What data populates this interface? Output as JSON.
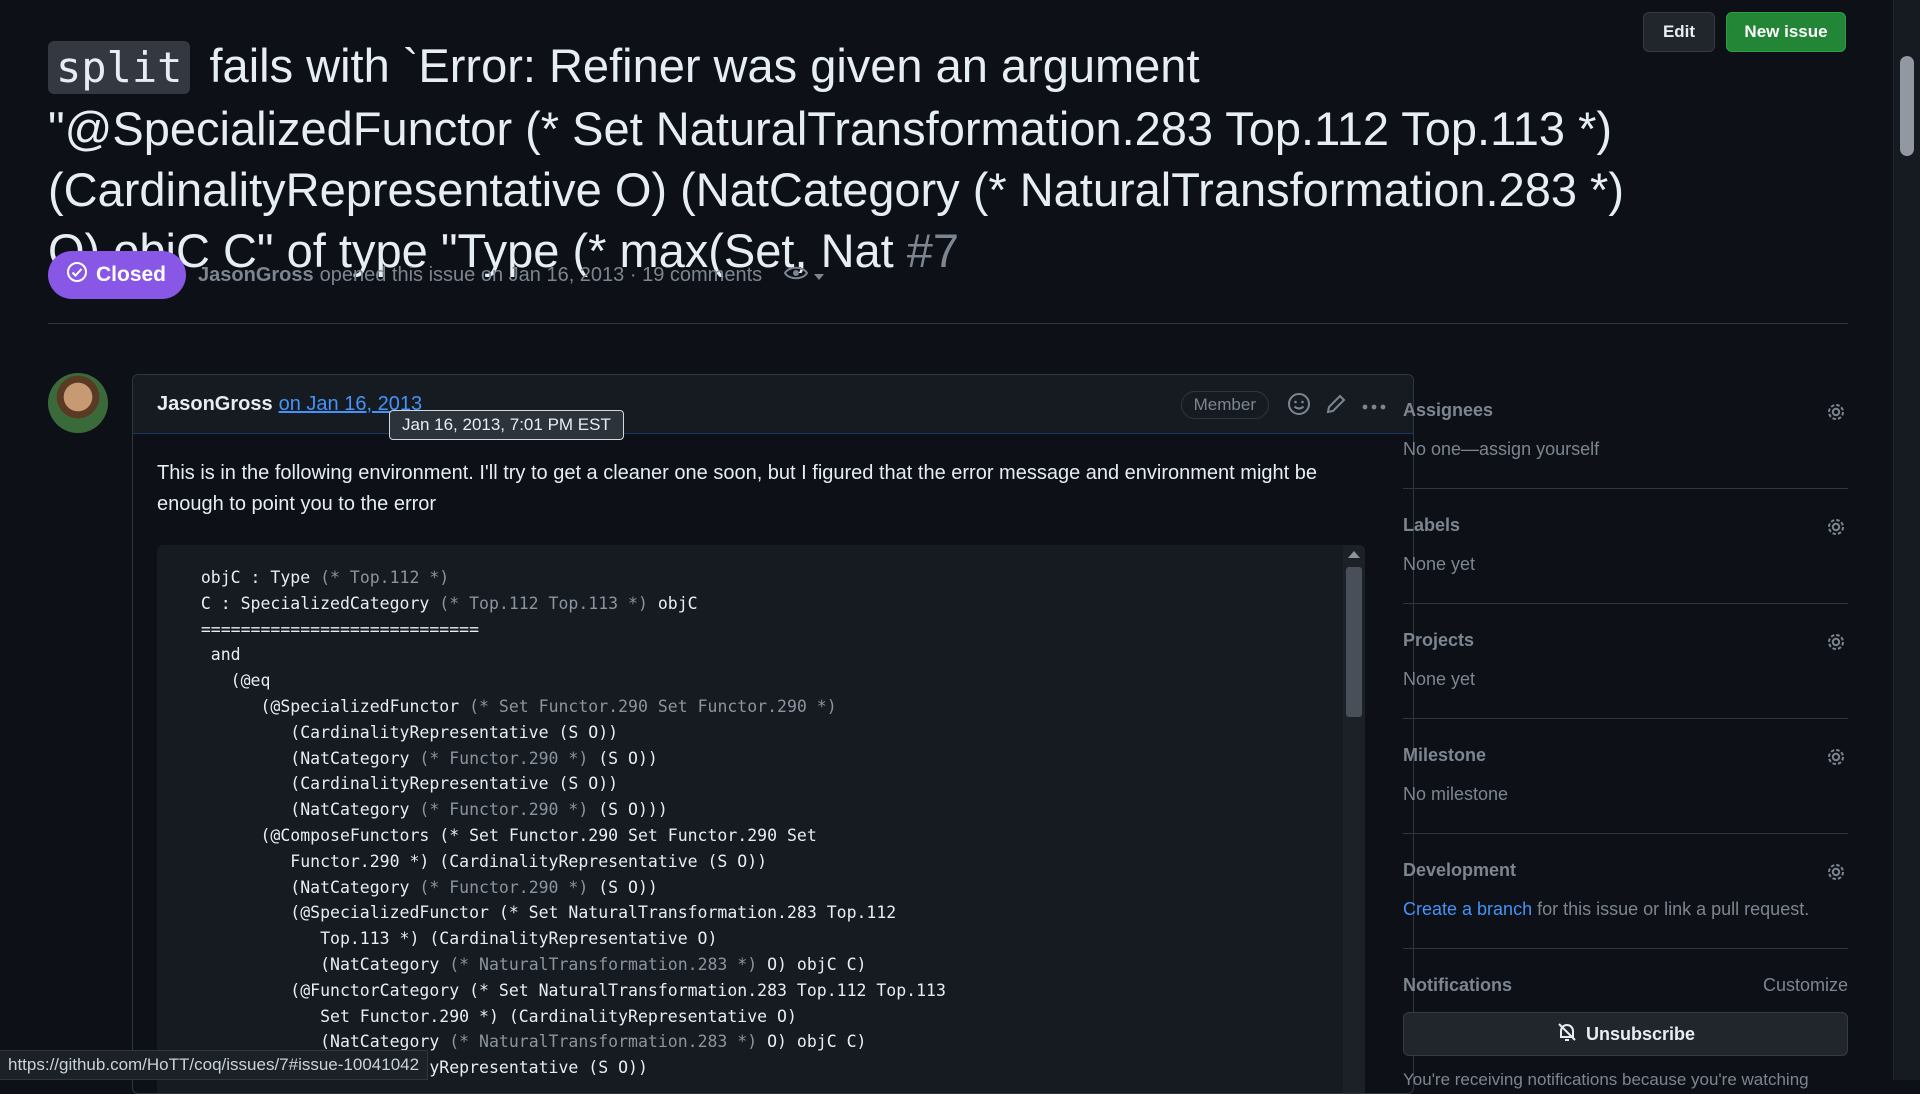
{
  "issue": {
    "title_code": "split",
    "title_text": " fails with `Error: Refiner was given an argument \"@SpecializedFunctor (* Set NaturalTransformation.283 Top.112 Top.113 *) (CardinalityRepresentative O) (NatCategory (* NaturalTransformation.283 *) O) objC C\" of type \"Type (* max(Set, Nat",
    "number": " #7",
    "status": "Closed",
    "author": "JasonGross",
    "opened_text": "opened this issue on Jan 16, 2013 · 19 comments"
  },
  "toolbar": {
    "edit_label": "Edit",
    "new_issue_label": "New issue"
  },
  "comment": {
    "author": "JasonGross",
    "date_link": "on Jan 16, 2013",
    "tooltip": "Jan 16, 2013, 7:01 PM EST",
    "badge": "Member",
    "body": "This is in the following environment. I'll try to get a cleaner one soon, but I figured that the error message and environment might be enough to point you to the error",
    "code_lines": [
      "  objC : Type (* Top.112 *)",
      "  C : SpecializedCategory (* Top.112 Top.113 *) objC",
      "  ============================",
      "   and",
      "     (@eq",
      "        (@SpecializedFunctor (* Set Functor.290 Set Functor.290 *)",
      "           (CardinalityRepresentative (S O))",
      "           (NatCategory (* Functor.290 *) (S O))",
      "           (CardinalityRepresentative (S O))",
      "           (NatCategory (* Functor.290 *) (S O)))",
      "        (@ComposeFunctors (* Set Functor.290 Set Functor.290 Set",
      "           Functor.290 *) (CardinalityRepresentative (S O))",
      "           (NatCategory (* Functor.290 *) (S O))",
      "           (@SpecializedFunctor (* Set NaturalTransformation.283 Top.112",
      "              Top.113 *) (CardinalityRepresentative O)",
      "              (NatCategory (* NaturalTransformation.283 *) O) objC C)",
      "           (@FunctorCategory (* Set NaturalTransformation.283 Top.112 Top.113",
      "              Set Functor.290 *) (CardinalityRepresentative O)",
      "              (NatCategory (* NaturalTransformation.283 *) O) objC C)",
      "              (CardinalityRepresentative (S O))"
    ]
  },
  "sidebar": {
    "assignees": {
      "title": "Assignees",
      "value": "No one—assign yourself"
    },
    "labels": {
      "title": "Labels",
      "value": "None yet"
    },
    "projects": {
      "title": "Projects",
      "value": "None yet"
    },
    "milestone": {
      "title": "Milestone",
      "value": "No milestone"
    },
    "development": {
      "title": "Development",
      "link": "Create a branch",
      "value": " for this issue or link a pull request."
    },
    "notifications": {
      "title": "Notifications",
      "customize": "Customize",
      "unsubscribe": "Unsubscribe",
      "note": "You're receiving notifications because you're watching"
    }
  },
  "statusbar": {
    "url": "https://github.com/HoTT/coq/issues/7#issue-10041042"
  },
  "colors": {
    "closed": "#8957e5",
    "new_issue": "#238636",
    "link": "#4493f8"
  }
}
